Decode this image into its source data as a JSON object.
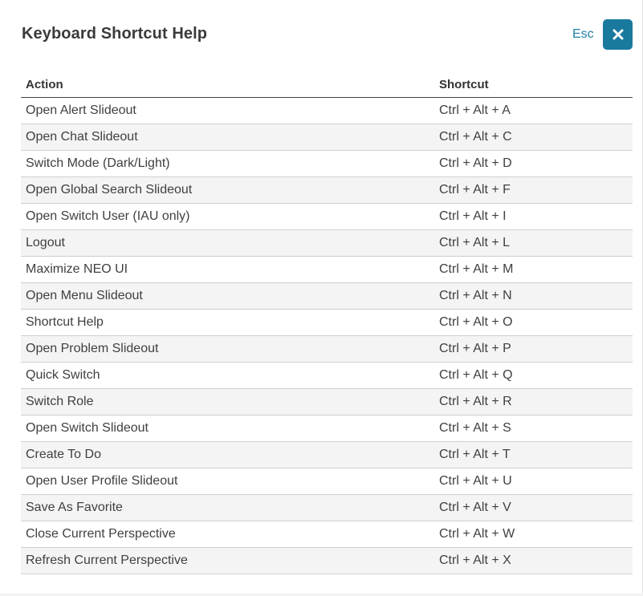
{
  "dialog": {
    "title": "Keyboard Shortcut Help",
    "esc_label": "Esc",
    "close_icon": "close-icon",
    "accent_color": "#1a7a9e"
  },
  "table": {
    "headers": {
      "action": "Action",
      "shortcut": "Shortcut"
    },
    "rows": [
      {
        "action": "Open Alert Slideout",
        "shortcut": "Ctrl + Alt + A"
      },
      {
        "action": "Open Chat Slideout",
        "shortcut": "Ctrl + Alt + C"
      },
      {
        "action": "Switch Mode (Dark/Light)",
        "shortcut": "Ctrl + Alt + D"
      },
      {
        "action": "Open Global Search Slideout",
        "shortcut": "Ctrl + Alt + F"
      },
      {
        "action": "Open Switch User (IAU only)",
        "shortcut": "Ctrl + Alt + I"
      },
      {
        "action": "Logout",
        "shortcut": "Ctrl + Alt + L"
      },
      {
        "action": "Maximize NEO UI",
        "shortcut": "Ctrl + Alt + M"
      },
      {
        "action": "Open Menu Slideout",
        "shortcut": "Ctrl + Alt + N"
      },
      {
        "action": "Shortcut Help",
        "shortcut": "Ctrl + Alt + O"
      },
      {
        "action": "Open Problem Slideout",
        "shortcut": "Ctrl + Alt + P"
      },
      {
        "action": "Quick Switch",
        "shortcut": "Ctrl + Alt + Q"
      },
      {
        "action": "Switch Role",
        "shortcut": "Ctrl + Alt + R"
      },
      {
        "action": "Open Switch Slideout",
        "shortcut": "Ctrl + Alt + S"
      },
      {
        "action": "Create To Do",
        "shortcut": "Ctrl + Alt + T"
      },
      {
        "action": "Open User Profile Slideout",
        "shortcut": "Ctrl + Alt + U"
      },
      {
        "action": "Save As Favorite",
        "shortcut": "Ctrl + Alt + V"
      },
      {
        "action": "Close Current Perspective",
        "shortcut": "Ctrl + Alt + W"
      },
      {
        "action": "Refresh Current Perspective",
        "shortcut": "Ctrl + Alt + X"
      }
    ]
  }
}
